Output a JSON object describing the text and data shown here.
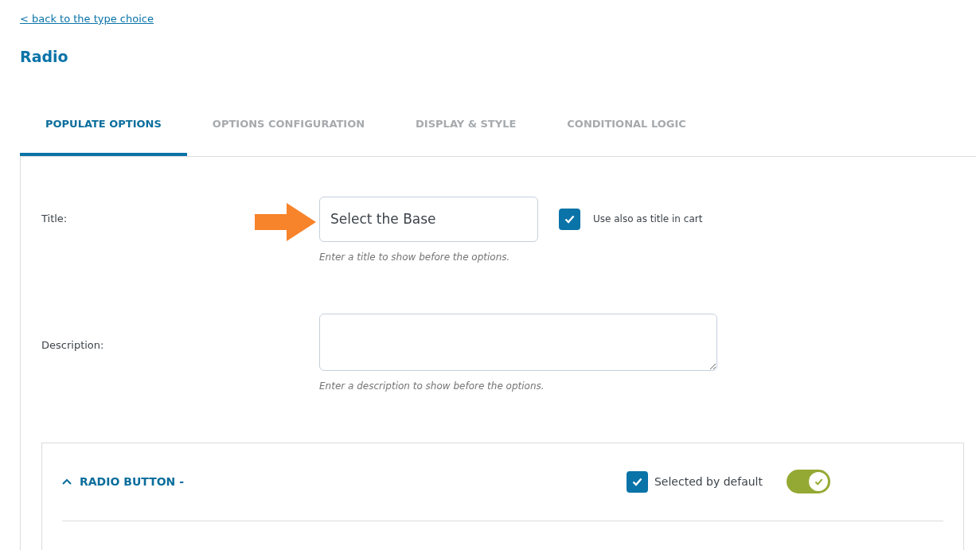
{
  "back_link": "< back to the type choice",
  "heading": "Radio",
  "tabs": [
    {
      "label": "POPULATE OPTIONS",
      "selected": true
    },
    {
      "label": "OPTIONS CONFIGURATION",
      "selected": false
    },
    {
      "label": "DISPLAY & STYLE",
      "selected": false
    },
    {
      "label": "CONDITIONAL LOGIC",
      "selected": false
    }
  ],
  "fields": [
    {
      "kind": "text",
      "label": "Title:",
      "value": "Select the Base",
      "help": "Enter a title to show before the options.",
      "checkbox": {
        "label": "Use also as title in cart",
        "checked": true
      }
    },
    {
      "kind": "textarea",
      "label": "Description:",
      "help": "Enter a description to show before the options."
    }
  ],
  "option": {
    "title": "RADIO BUTTON -",
    "expanded": true,
    "selected_by_default": {
      "label": "Selected by default",
      "checked": true
    },
    "enabled": true
  }
}
